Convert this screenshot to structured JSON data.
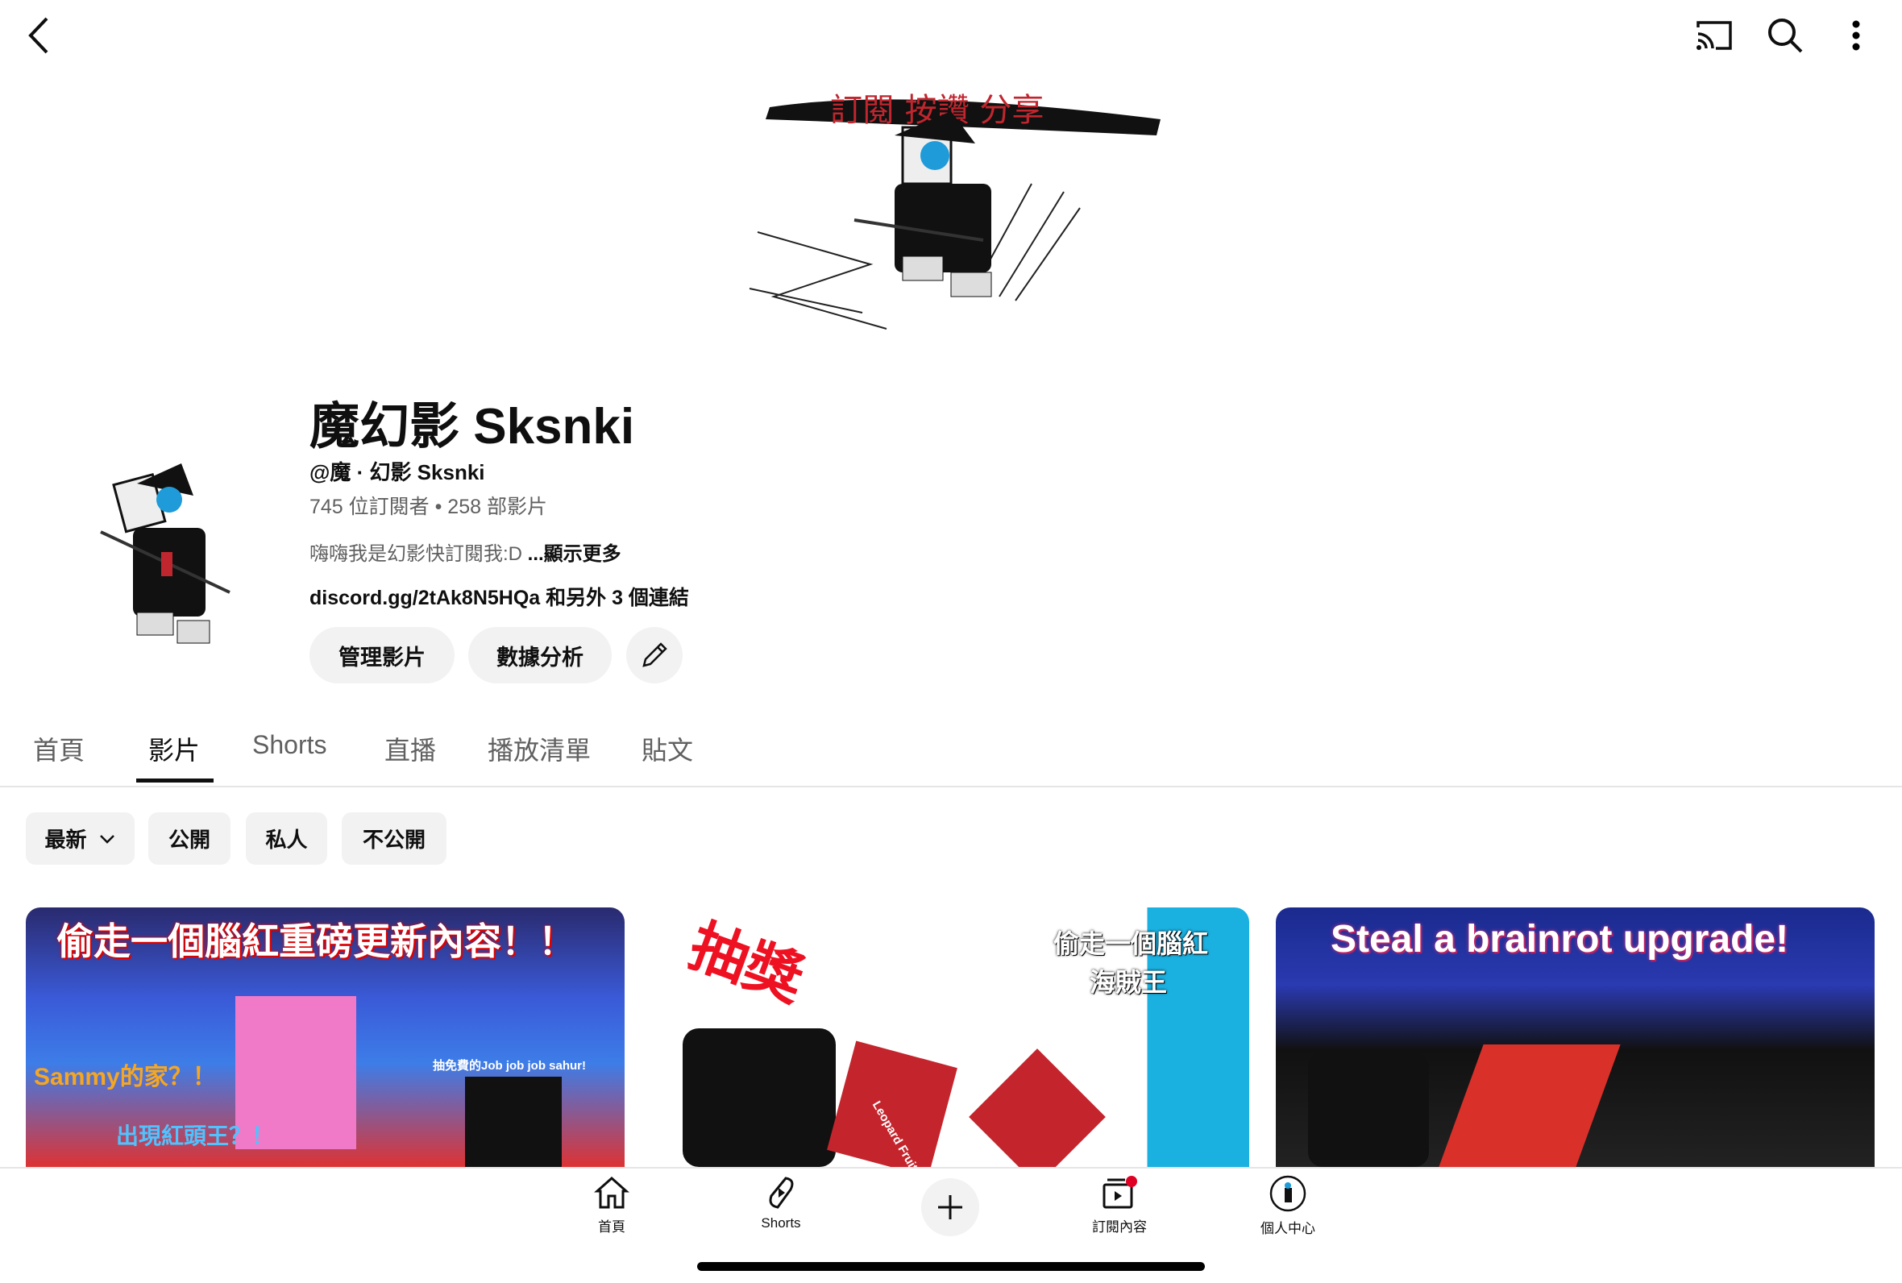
{
  "topbar": {
    "back_icon": "chevron-left-icon",
    "cast_icon": "cast-icon",
    "search_icon": "search-icon",
    "more_icon": "more-vertical-icon"
  },
  "banner": {
    "text": "訂閱  按讚  分享"
  },
  "channel": {
    "name": "魔幻影 Sksnki",
    "handle": "@魔 · 幻影 Sksnki",
    "stats": "745 位訂閱者 • 258 部影片",
    "description": "嗨嗨我是幻影快訂閱我:D ",
    "show_more": "...顯示更多",
    "link": "discord.gg/2tAk8N5HQa 和另外 3 個連結"
  },
  "actions": {
    "manage": "管理影片",
    "analytics": "數據分析",
    "edit_icon": "pencil-icon"
  },
  "tabs": [
    {
      "label": "首頁"
    },
    {
      "label": "影片",
      "active": true
    },
    {
      "label": "Shorts"
    },
    {
      "label": "直播"
    },
    {
      "label": "播放清單"
    },
    {
      "label": "貼文"
    }
  ],
  "filters": [
    {
      "label": "最新",
      "dropdown": true
    },
    {
      "label": "公開"
    },
    {
      "label": "私人"
    },
    {
      "label": "不公開"
    }
  ],
  "videos": [
    {
      "title_overlay": "偷走一個腦紅重磅更新內容！！",
      "overlay2": "Sammy的家？！",
      "overlay3": "出現紅頭王？！",
      "overlay4": "抽免費的Job job job sahur!"
    },
    {
      "title_overlay": "抽獎",
      "overlay2": "偷走一個腦紅",
      "overlay3": "海賊王",
      "overlay4": "Leopard Fruit"
    },
    {
      "title_overlay": "Steal a brainrot upgrade!"
    }
  ],
  "bottom_nav": [
    {
      "label": "首頁",
      "icon": "home-icon"
    },
    {
      "label": "Shorts",
      "icon": "shorts-icon"
    },
    {
      "label": "",
      "icon": "plus-icon"
    },
    {
      "label": "訂閱內容",
      "icon": "subscriptions-icon",
      "badge_color": "#e00024"
    },
    {
      "label": "個人中心",
      "icon": "avatar-icon"
    }
  ],
  "colors": {
    "accent": "#0f0f0f",
    "chip_bg": "#f2f2f2",
    "badge": "#e00024"
  }
}
